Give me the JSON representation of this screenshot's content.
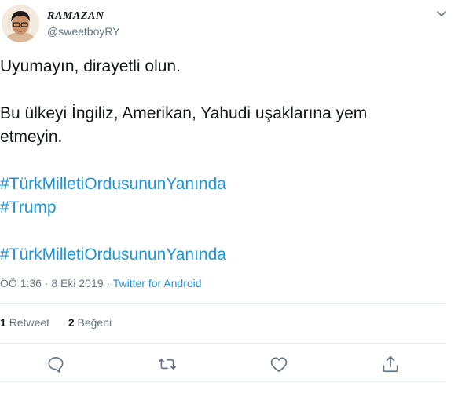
{
  "user": {
    "display_name": "RAMAZAN",
    "handle": "@sweetboyRY"
  },
  "tweet": {
    "line1": "Uyumayın, dirayetli olun.",
    "line2": "Bu ülkeyi İngiliz, Amerikan, Yahudi uşaklarına yem",
    "line3": "etmeyin.",
    "hashtag1": "#TürkMilletiOrdusununYanında",
    "hashtag2": "#Trump",
    "hashtag3": "#TürkMilletiOrdusununYanında"
  },
  "meta": {
    "time_date": "ÖÖ 1:36 · 8 Eki 2019 · ",
    "source": "Twitter for Android"
  },
  "stats": {
    "retweet_count": "1",
    "retweet_label": "Retweet",
    "like_count": "2",
    "like_label": "Beğeni"
  },
  "colors": {
    "link": "#1b95e0",
    "secondary_text": "#657786",
    "divider": "#e6ecf0"
  },
  "icons": [
    "chevron-down-icon",
    "reply-icon",
    "retweet-icon",
    "like-icon",
    "share-icon"
  ]
}
